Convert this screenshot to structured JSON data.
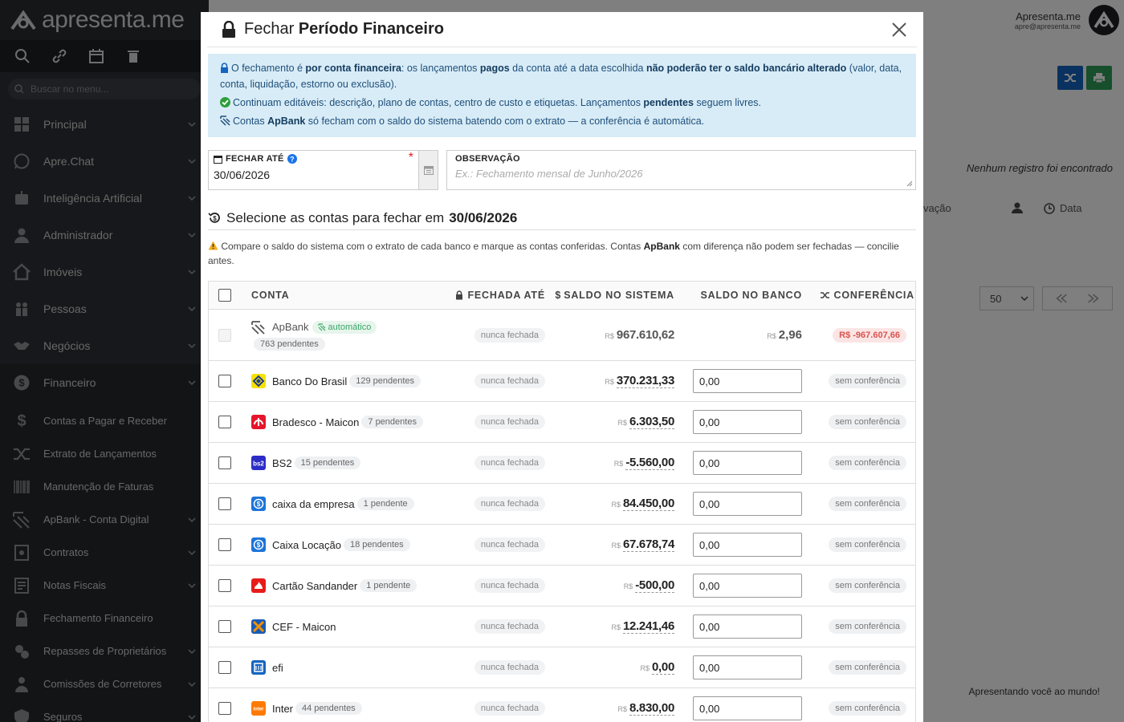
{
  "app": {
    "logo_text": "apresenta.me",
    "search_placeholder": "Buscar no menu...",
    "user_name": "Apresenta.me",
    "user_email": "apre@apresenta.me",
    "empty_message": "Nenhum registro foi encontrado",
    "col_obs": "vação",
    "col_data": "Data",
    "page_size": "50",
    "footer": "Apresentando você ao mundo!"
  },
  "sidebar": {
    "items": [
      {
        "label": "Principal",
        "icon": "dashboard-icon"
      },
      {
        "label": "Apre.Chat",
        "icon": "whatsapp-icon"
      },
      {
        "label": "Inteligência Artificial",
        "icon": "robot-icon"
      },
      {
        "label": "Administrador",
        "icon": "user-admin-icon"
      },
      {
        "label": "Imóveis",
        "icon": "home-icon"
      },
      {
        "label": "Pessoas",
        "icon": "people-icon"
      },
      {
        "label": "Negócios",
        "icon": "handshake-icon"
      },
      {
        "label": "Financeiro",
        "icon": "dollar-icon"
      }
    ],
    "sub_items": [
      {
        "label": "Contas a Pagar e Receber",
        "icon": "dollar-sign-icon"
      },
      {
        "label": "Extrato de Lançamentos",
        "icon": "shuffle-icon"
      },
      {
        "label": "Manutenção de Faturas",
        "icon": "barcode-icon"
      },
      {
        "label": "ApBank - Conta Digital",
        "icon": "apbank-icon"
      },
      {
        "label": "Contratos",
        "icon": "contract-icon"
      },
      {
        "label": "Notas Fiscais",
        "icon": "invoice-icon"
      },
      {
        "label": "Fechamento Financeiro",
        "icon": "lock-icon"
      },
      {
        "label": "Repasses de Proprietários",
        "icon": "transfer-icon"
      },
      {
        "label": "Comissões de Corretores",
        "icon": "broker-icon"
      },
      {
        "label": "Seguros",
        "icon": "insurance-icon"
      }
    ]
  },
  "modal": {
    "title_prefix": "Fechar",
    "title_bold": "Período Financeiro",
    "info": {
      "l1_a": "O fechamento é ",
      "l1_b": "por conta financeira",
      "l1_c": ": os lançamentos ",
      "l1_d": "pagos",
      "l1_e": " da conta até a data escolhida ",
      "l1_f": "não poderão ter o saldo bancário alterado",
      "l1_g": " (valor, data, conta, liquidação, estorno ou exclusão).",
      "l2_a": "Continuam editáveis: descrição, plano de contas, centro de custo e etiquetas. Lançamentos ",
      "l2_b": "pendentes",
      "l2_c": " seguem livres.",
      "l3_a": "Contas ",
      "l3_b": "ApBank",
      "l3_c": " só fecham com o saldo do sistema batendo com o extrato — a conferência é automática."
    },
    "date_label": "FECHAR ATÉ",
    "date_value": "30/06/2026",
    "obs_label": "OBSERVAÇÃO",
    "obs_placeholder": "Ex.: Fechamento mensal de Junho/2026",
    "section_prefix": "Selecione as contas para fechar em",
    "section_date": "30/06/2026",
    "warn_a": "Compare o saldo do sistema com o extrato de cada banco e marque as contas conferidas. Contas ",
    "warn_b": "ApBank",
    "warn_c": " com diferença não podem ser fechadas — concilie antes."
  },
  "table": {
    "headers": {
      "conta": "CONTA",
      "fechada": "FECHADA ATÉ",
      "saldo": "SALDO NO SISTEMA",
      "banco": "SALDO NO BANCO",
      "conf": "CONFERÊNCIA"
    },
    "apbank": {
      "name": "ApBank",
      "auto": "automático",
      "pending": "763 pendentes",
      "closed": "nunca fechada",
      "currency": "R$",
      "system": "967.610,62",
      "bank": "2,96",
      "diff": "R$ -967.607,66"
    },
    "rows": [
      {
        "name": "Banco Do Brasil",
        "pending": "129 pendentes",
        "closed": "nunca fechada",
        "currency": "R$",
        "system": "370.231,33",
        "bank": "0,00",
        "conf": "sem conferência",
        "icon": "bb-icon"
      },
      {
        "name": "Bradesco - Maicon",
        "pending": "7 pendentes",
        "closed": "nunca fechada",
        "currency": "R$",
        "system": "6.303,50",
        "bank": "0,00",
        "conf": "sem conferência",
        "icon": "bradesco-icon"
      },
      {
        "name": "BS2",
        "pending": "15 pendentes",
        "closed": "nunca fechada",
        "currency": "R$",
        "system": "-5.560,00",
        "bank": "0,00",
        "conf": "sem conferência",
        "icon": "bs2-icon"
      },
      {
        "name": "caixa da empresa",
        "pending": "1 pendente",
        "closed": "nunca fechada",
        "currency": "R$",
        "system": "84.450,00",
        "bank": "0,00",
        "conf": "sem conferência",
        "icon": "caixa-icon"
      },
      {
        "name": "Caixa Locação",
        "pending": "18 pendentes",
        "closed": "nunca fechada",
        "currency": "R$",
        "system": "67.678,74",
        "bank": "0,00",
        "conf": "sem conferência",
        "icon": "caixa-icon"
      },
      {
        "name": "Cartão Sandander",
        "pending": "1 pendente",
        "closed": "nunca fechada",
        "currency": "R$",
        "system": "-500,00",
        "bank": "0,00",
        "conf": "sem conferência",
        "icon": "santander-icon"
      },
      {
        "name": "CEF - Maicon",
        "pending": "",
        "closed": "nunca fechada",
        "currency": "R$",
        "system": "12.241,46",
        "bank": "0,00",
        "conf": "sem conferência",
        "icon": "cef-icon"
      },
      {
        "name": "efi",
        "pending": "",
        "closed": "nunca fechada",
        "currency": "R$",
        "system": "0,00",
        "bank": "0,00",
        "conf": "sem conferência",
        "icon": "bank-building-icon"
      },
      {
        "name": "Inter",
        "pending": "44 pendentes",
        "closed": "nunca fechada",
        "currency": "R$",
        "system": "8.830,00",
        "bank": "0,00",
        "conf": "sem conferência",
        "icon": "inter-icon"
      }
    ]
  }
}
